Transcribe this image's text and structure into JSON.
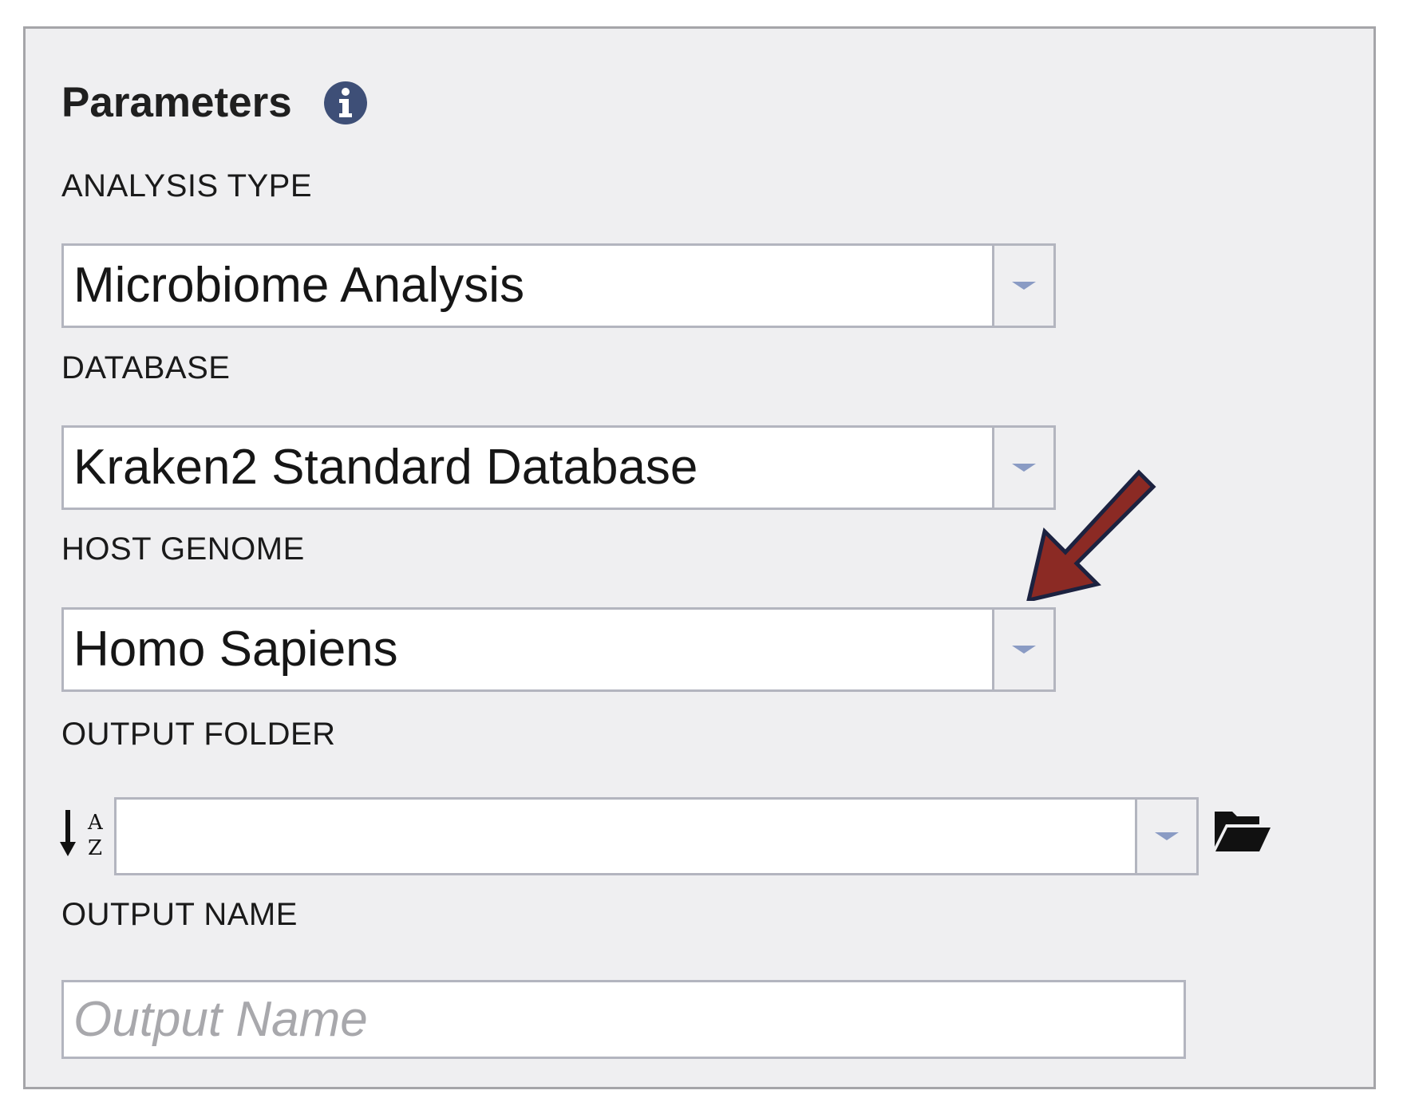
{
  "panel": {
    "title": "Parameters",
    "info_icon": "info-circle-icon"
  },
  "fields": {
    "analysis_type": {
      "label": "ANALYSIS TYPE",
      "value": "Microbiome Analysis"
    },
    "database": {
      "label": "DATABASE",
      "value": "Kraken2 Standard Database"
    },
    "host_genome": {
      "label": "HOST GENOME",
      "value": "Homo Sapiens"
    },
    "output_folder": {
      "label": "OUTPUT FOLDER",
      "value": "",
      "sort_icon": "sort-alpha-down-icon",
      "browse_icon": "folder-open-icon"
    },
    "output_name": {
      "label": "OUTPUT NAME",
      "value": "",
      "placeholder": "Output Name"
    }
  },
  "annotation": {
    "arrow_icon": "pointer-arrow-icon",
    "arrow_color": "#8b2a24",
    "arrow_outline": "#1c2240"
  },
  "colors": {
    "panel_bg": "#efeff1",
    "border": "#b3b5bf",
    "caret": "#8a9bc4",
    "info_icon": "#3e4f77"
  }
}
